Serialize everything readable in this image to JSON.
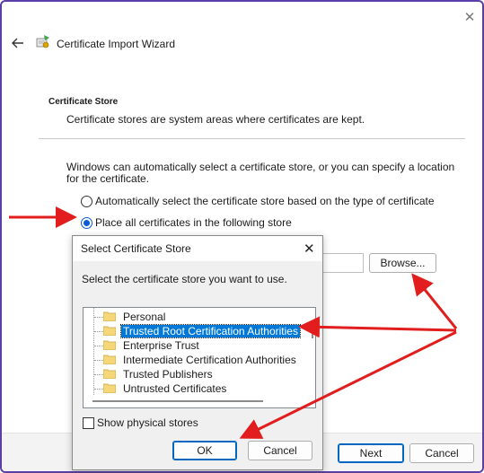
{
  "window": {
    "title": "Certificate Import Wizard",
    "close_glyph": "✕"
  },
  "section": {
    "title": "Certificate Store",
    "description": "Certificate stores are system areas where certificates are kept."
  },
  "body_text": "Windows can automatically select a certificate store, or you can specify a location for the certificate.",
  "options": {
    "auto": {
      "label": "Automatically select the certificate store based on the type of certificate",
      "selected": false
    },
    "manual": {
      "label": "Place all certificates in the following store",
      "selected": true
    }
  },
  "store_field": {
    "value": ""
  },
  "browse_label": "Browse...",
  "footer": {
    "next_label": "Next",
    "cancel_label": "Cancel"
  },
  "dialog": {
    "title": "Select Certificate Store",
    "close_glyph": "✕",
    "prompt": "Select the certificate store you want to use.",
    "stores": [
      {
        "label": "Personal",
        "selected": false
      },
      {
        "label": "Trusted Root Certification Authorities",
        "selected": true
      },
      {
        "label": "Enterprise Trust",
        "selected": false
      },
      {
        "label": "Intermediate Certification Authorities",
        "selected": false
      },
      {
        "label": "Trusted Publishers",
        "selected": false
      },
      {
        "label": "Untrusted Certificates",
        "selected": false
      }
    ],
    "show_physical": {
      "label": "Show physical stores",
      "checked": false
    },
    "ok_label": "OK",
    "cancel_label": "Cancel"
  },
  "colors": {
    "annotation_arrow": "#e11d1d",
    "window_border": "#5b3fa8",
    "accent": "#0078d7",
    "folder": "#f5d77a"
  },
  "icons": [
    "back-arrow-icon",
    "certificate-wizard-icon",
    "close-icon",
    "folder-icon"
  ]
}
